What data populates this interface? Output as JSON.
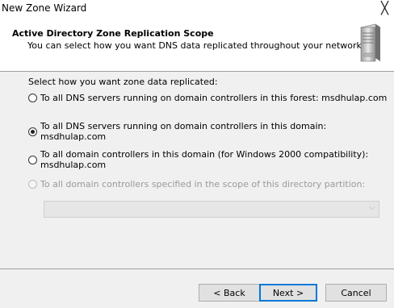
{
  "window": {
    "title": "New Zone Wizard",
    "close_glyph": "╳"
  },
  "header": {
    "title": "Active Directory Zone Replication Scope",
    "subtitle": "You can select how you want DNS data replicated throughout your network.",
    "icon": "server-icon"
  },
  "main": {
    "prompt": "Select how you want zone data replicated:",
    "options": [
      {
        "label": "To all DNS servers running on domain controllers in this forest: msdhulap.com",
        "selected": false,
        "enabled": true
      },
      {
        "label": "To all DNS servers running on domain controllers in this domain: msdhulap.com",
        "selected": true,
        "enabled": true
      },
      {
        "label": "To all domain controllers in this domain (for Windows 2000 compatibility): msdhulap.com",
        "selected": false,
        "enabled": true
      },
      {
        "label": "To all domain controllers specified in the scope of this directory partition:",
        "selected": false,
        "enabled": false
      }
    ],
    "partition_select": {
      "value": "",
      "enabled": false
    }
  },
  "buttons": {
    "back": "< Back",
    "next": "Next >",
    "cancel": "Cancel"
  }
}
